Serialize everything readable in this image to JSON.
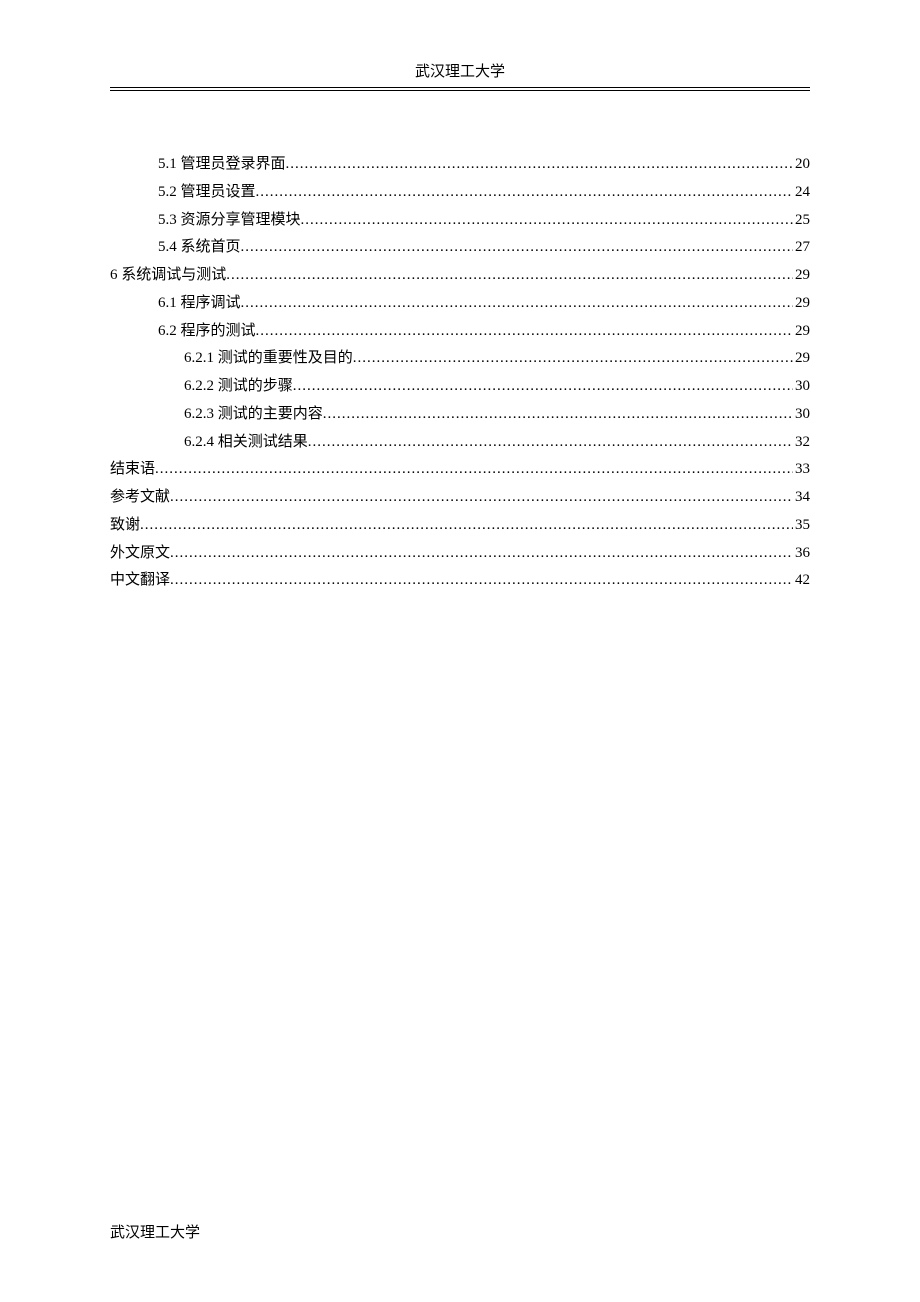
{
  "header": {
    "title": "武汉理工大学"
  },
  "toc": {
    "entries": [
      {
        "indent": 1,
        "label": "5.1  管理员登录界面",
        "page": "20"
      },
      {
        "indent": 1,
        "label": "5.2  管理员设置",
        "page": "24"
      },
      {
        "indent": 1,
        "label": "5.3  资源分享管理模块",
        "page": "25"
      },
      {
        "indent": 1,
        "label": "5.4  系统首页",
        "page": "27"
      },
      {
        "indent": 0,
        "label": "6  系统调试与测试",
        "page": "29"
      },
      {
        "indent": 1,
        "label": "6.1  程序调试",
        "page": "29"
      },
      {
        "indent": 1,
        "label": "6.2  程序的测试",
        "page": "29"
      },
      {
        "indent": 2,
        "label": "6.2.1  测试的重要性及目的",
        "page": "29"
      },
      {
        "indent": 2,
        "label": "6.2.2  测试的步骤",
        "page": "30"
      },
      {
        "indent": 2,
        "label": "6.2.3  测试的主要内容",
        "page": "30"
      },
      {
        "indent": 2,
        "label": "6.2.4  相关测试结果",
        "page": "32"
      },
      {
        "indent": 0,
        "label": "结束语",
        "page": "33"
      },
      {
        "indent": 0,
        "label": "参考文献",
        "page": "34"
      },
      {
        "indent": 0,
        "label": "致谢",
        "page": "35"
      },
      {
        "indent": 0,
        "label": "外文原文",
        "page": "36"
      },
      {
        "indent": 0,
        "label": "中文翻译",
        "page": "42"
      }
    ]
  },
  "footer": {
    "text": "武汉理工大学"
  }
}
